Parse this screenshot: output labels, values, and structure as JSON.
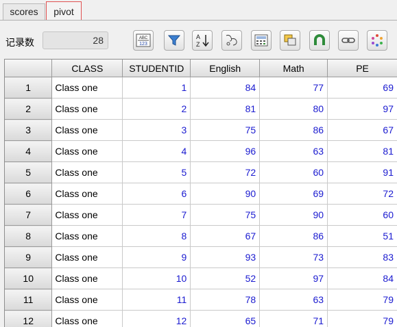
{
  "tabs": [
    {
      "label": "scores",
      "active": false
    },
    {
      "label": "pivot",
      "active": true
    }
  ],
  "toolbar": {
    "record_label": "记录数",
    "record_count": "28",
    "buttons": [
      {
        "icon": "abc-123-icon"
      },
      {
        "icon": "filter-icon"
      },
      {
        "icon": "sort-az-icon"
      },
      {
        "icon": "group-icon"
      },
      {
        "icon": "calculator-icon"
      },
      {
        "icon": "copy-icon"
      },
      {
        "icon": "magnet-icon"
      },
      {
        "icon": "link-icon"
      },
      {
        "icon": "refresh-icon"
      }
    ]
  },
  "colors": {
    "number_text": "#1a1ad0",
    "active_tab_border": "#e05050"
  },
  "grid": {
    "columns": [
      "CLASS",
      "STUDENTID",
      "English",
      "Math",
      "PE"
    ],
    "rows": [
      {
        "row": "1",
        "cells": [
          "Class one",
          "1",
          "84",
          "77",
          "69"
        ]
      },
      {
        "row": "2",
        "cells": [
          "Class one",
          "2",
          "81",
          "80",
          "97"
        ]
      },
      {
        "row": "3",
        "cells": [
          "Class one",
          "3",
          "75",
          "86",
          "67"
        ]
      },
      {
        "row": "4",
        "cells": [
          "Class one",
          "4",
          "96",
          "63",
          "81"
        ]
      },
      {
        "row": "5",
        "cells": [
          "Class one",
          "5",
          "72",
          "60",
          "91"
        ]
      },
      {
        "row": "6",
        "cells": [
          "Class one",
          "6",
          "90",
          "69",
          "72"
        ]
      },
      {
        "row": "7",
        "cells": [
          "Class one",
          "7",
          "75",
          "90",
          "60"
        ]
      },
      {
        "row": "8",
        "cells": [
          "Class one",
          "8",
          "67",
          "86",
          "51"
        ]
      },
      {
        "row": "9",
        "cells": [
          "Class one",
          "9",
          "93",
          "73",
          "83"
        ]
      },
      {
        "row": "10",
        "cells": [
          "Class one",
          "10",
          "52",
          "97",
          "84"
        ]
      },
      {
        "row": "11",
        "cells": [
          "Class one",
          "11",
          "78",
          "63",
          "79"
        ]
      },
      {
        "row": "12",
        "cells": [
          "Class one",
          "12",
          "65",
          "71",
          "79"
        ]
      }
    ]
  }
}
